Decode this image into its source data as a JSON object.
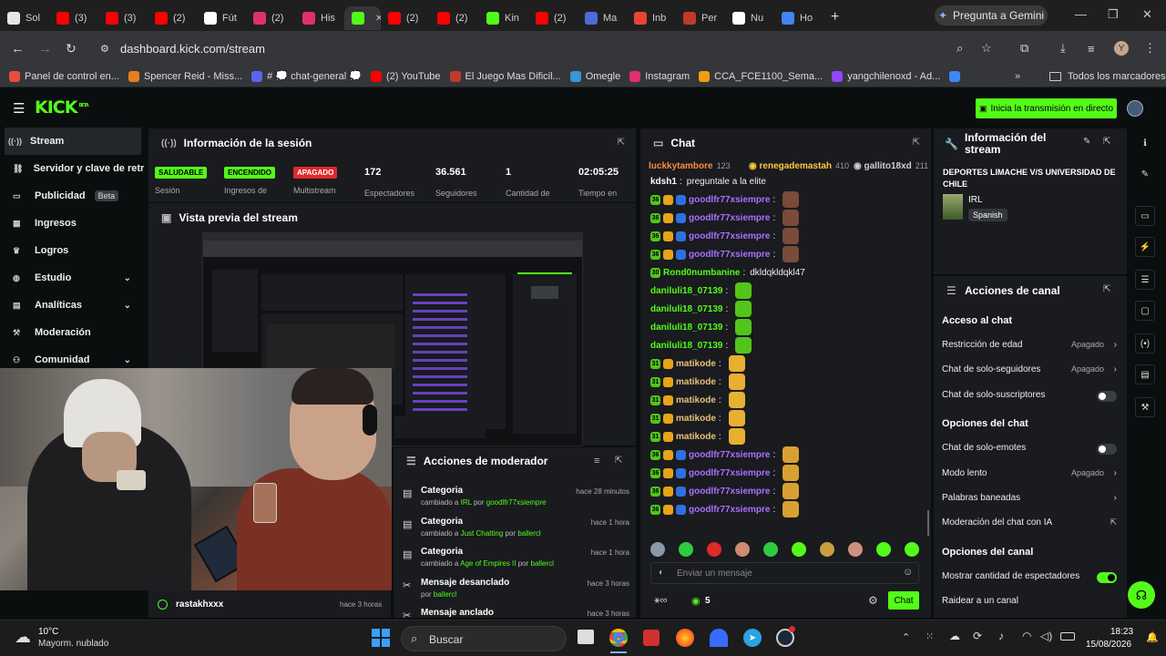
{
  "browser": {
    "tabs": [
      {
        "label": "Sol",
        "color": "#e6e6e6"
      },
      {
        "label": "(3)",
        "color": "#ff0000"
      },
      {
        "label": "(3)",
        "color": "#ff0000"
      },
      {
        "label": "(2)",
        "color": "#ff0000"
      },
      {
        "label": "Fút",
        "color": "#ffffff"
      },
      {
        "label": "(2)",
        "color": "#e1306c"
      },
      {
        "label": "His",
        "color": "#e1306c"
      },
      {
        "label": "",
        "color": "#53fc18"
      },
      {
        "label": "(2)",
        "color": "#ff0000"
      },
      {
        "label": "(2)",
        "color": "#ff0000"
      },
      {
        "label": "Kin",
        "color": "#53fc18"
      },
      {
        "label": "(2)",
        "color": "#ff0000"
      },
      {
        "label": "Ma",
        "color": "#4d6ad6"
      },
      {
        "label": "Inb",
        "color": "#ea4335"
      },
      {
        "label": "Per",
        "color": "#c0392b"
      },
      {
        "label": "Nu",
        "color": "#ffffff"
      },
      {
        "label": "Ho",
        "color": "#4285f4"
      }
    ],
    "new_tab": "+",
    "gemini_label": "Pregunta a Gemini",
    "url": "dashboard.kick.com/stream",
    "profile_initial": "Y",
    "bookmarks": [
      {
        "label": "Panel de control en...",
        "color": "#e74c3c"
      },
      {
        "label": "Spencer Reid - Miss...",
        "color": "#e67e22"
      },
      {
        "label": "# 💭 chat-general 💭",
        "color": "#5865f2"
      },
      {
        "label": "(2) YouTube",
        "color": "#ff0000"
      },
      {
        "label": "El Juego Mas Dificil...",
        "color": "#c0392b"
      },
      {
        "label": "Omegle",
        "color": "#3498db"
      },
      {
        "label": "Instagram",
        "color": "#e1306c"
      },
      {
        "label": "CCA_FCE1100_Sema...",
        "color": "#f39c12"
      },
      {
        "label": "yangchilenoxd - Ad...",
        "color": "#9146ff"
      },
      {
        "label": "",
        "color": "#4285f4"
      }
    ],
    "all_bookmarks": "Todos los marcadores"
  },
  "kick": {
    "logo": "KICK",
    "logo_sup": "BETA",
    "go_live": "Inicia la transmisión en directo"
  },
  "sidebar": {
    "items": [
      {
        "label": "Stream",
        "icon": "stream-icon",
        "chev": ""
      },
      {
        "label": "Servidor y clave de retran",
        "icon": "link-icon",
        "chev": ""
      },
      {
        "label": "Publicidad",
        "icon": "tv-icon",
        "chev": "",
        "badge": "Beta"
      },
      {
        "label": "Ingresos",
        "icon": "grid-icon",
        "chev": ""
      },
      {
        "label": "Logros",
        "icon": "trophy-icon",
        "chev": ""
      },
      {
        "label": "Estudio",
        "icon": "palette-icon",
        "chev": "⌄"
      },
      {
        "label": "Analíticas",
        "icon": "chart-icon",
        "chev": "⌄"
      },
      {
        "label": "Moderación",
        "icon": "gavel-icon",
        "chev": ""
      },
      {
        "label": "Comunidad",
        "icon": "people-icon",
        "chev": "⌄"
      }
    ]
  },
  "session": {
    "title": "Información de la sesión",
    "stats": [
      {
        "badge": "SALUDABLE",
        "badge_bg": "#53fc18",
        "badge_fg": "#000",
        "label": "Sesión"
      },
      {
        "badge": "ENCENDIDO",
        "badge_bg": "#53fc18",
        "badge_fg": "#000",
        "label": "Ingresos de"
      },
      {
        "badge": "APAGADO",
        "badge_bg": "#e0292b",
        "badge_fg": "#fff",
        "label": "Multistream"
      },
      {
        "value": "172",
        "label": "Espectadores"
      },
      {
        "value": "36.561",
        "label": "Seguidores"
      },
      {
        "value": "1",
        "label": "Cantidad de"
      },
      {
        "value": "02:05:25",
        "label": "Tiempo en"
      }
    ]
  },
  "preview": {
    "title": "Vista previa del stream"
  },
  "moderator": {
    "title": "Acciones de moderador",
    "items": [
      {
        "title": "Categoria",
        "pre": "cambiado a ",
        "target": "IRL",
        "mid": " por ",
        "user": "goodlfr77xsiempre",
        "when": "hace 28 minutos"
      },
      {
        "title": "Categoria",
        "pre": "cambiado a ",
        "target": "Just Chatting",
        "mid": " por ",
        "user": "ballercl",
        "when": "hace 1 hora"
      },
      {
        "title": "Categoria",
        "pre": "cambiado a ",
        "target": "Age of Empires II",
        "mid": " por ",
        "user": "ballercl",
        "when": "hace 1 hora"
      },
      {
        "title": "Mensaje desanclado",
        "pre": "",
        "target": "",
        "mid": "por ",
        "user": "ballercl",
        "when": "hace 3 horas"
      },
      {
        "title": "Mensaje anclado",
        "pre": "",
        "target": "",
        "mid": "",
        "user": "",
        "when": "hace 3 horas"
      }
    ]
  },
  "activity": {
    "user": "rastakhxxx",
    "when": "hace 3 horas"
  },
  "chat": {
    "title": "Chat",
    "top_users": [
      {
        "name": "luckkytambore",
        "count": "123"
      },
      {
        "name": "renegademastah",
        "count": "410"
      },
      {
        "name": "gallito18xd",
        "count": "211"
      }
    ],
    "messages": [
      {
        "user": "kdsh1",
        "color": "#ffffff",
        "text": "preguntale a la elite",
        "badges": [],
        "emote": ""
      },
      {
        "user": "goodlfr77xsiempre",
        "color": "#a970ff",
        "text": "",
        "badges": [
          "36",
          "crown",
          "bolt"
        ],
        "emote": "#7a4a3a"
      },
      {
        "user": "goodlfr77xsiempre",
        "color": "#a970ff",
        "text": "",
        "badges": [
          "36",
          "crown",
          "bolt"
        ],
        "emote": "#7a4a3a"
      },
      {
        "user": "goodlfr77xsiempre",
        "color": "#a970ff",
        "text": "",
        "badges": [
          "36",
          "crown",
          "bolt"
        ],
        "emote": "#7a4a3a"
      },
      {
        "user": "goodlfr77xsiempre",
        "color": "#a970ff",
        "text": "",
        "badges": [
          "36",
          "crown",
          "bolt"
        ],
        "emote": "#7a4a3a"
      },
      {
        "user": "Rond0numbanine",
        "color": "#53fc18",
        "text": "dkldqkldqkl47",
        "badges": [
          "30"
        ],
        "emote": ""
      },
      {
        "user": "daniluli18_07139",
        "color": "#53fc18",
        "text": "",
        "badges": [],
        "emote": "#53c51a"
      },
      {
        "user": "daniluli18_07139",
        "color": "#53fc18",
        "text": "",
        "badges": [],
        "emote": "#53c51a"
      },
      {
        "user": "daniluli18_07139",
        "color": "#53fc18",
        "text": "",
        "badges": [],
        "emote": "#53c51a"
      },
      {
        "user": "daniluli18_07139",
        "color": "#53fc18",
        "text": "",
        "badges": [],
        "emote": "#53c51a"
      },
      {
        "user": "matikode",
        "color": "#e5c07b",
        "text": "",
        "badges": [
          "31",
          "crown"
        ],
        "emote": "#e8b030"
      },
      {
        "user": "matikode",
        "color": "#e5c07b",
        "text": "",
        "badges": [
          "31",
          "crown"
        ],
        "emote": "#e8b030"
      },
      {
        "user": "matikode",
        "color": "#e5c07b",
        "text": "",
        "badges": [
          "31",
          "crown"
        ],
        "emote": "#e8b030"
      },
      {
        "user": "matikode",
        "color": "#e5c07b",
        "text": "",
        "badges": [
          "31",
          "crown"
        ],
        "emote": "#e8b030"
      },
      {
        "user": "matikode",
        "color": "#e5c07b",
        "text": "",
        "badges": [
          "31",
          "crown"
        ],
        "emote": "#e8b030"
      },
      {
        "user": "goodlfr77xsiempre",
        "color": "#a970ff",
        "text": "",
        "badges": [
          "36",
          "crown",
          "bolt"
        ],
        "emote": "#d8a030"
      },
      {
        "user": "goodlfr77xsiempre",
        "color": "#a970ff",
        "text": "",
        "badges": [
          "36",
          "crown",
          "bolt"
        ],
        "emote": "#d8a030"
      },
      {
        "user": "goodlfr77xsiempre",
        "color": "#a970ff",
        "text": "",
        "badges": [
          "36",
          "crown",
          "bolt"
        ],
        "emote": "#d8a030"
      },
      {
        "user": "goodlfr77xsiempre",
        "color": "#a970ff",
        "text": "",
        "badges": [
          "36",
          "crown",
          "bolt"
        ],
        "emote": "#d8a030"
      }
    ],
    "emote_bar": [
      "#8899aa",
      "#2ecc40",
      "#e0292b",
      "#d08a70",
      "#2ecc40",
      "#53fc18",
      "#c8a040",
      "#d09080",
      "#53fc18",
      "#53fc18"
    ],
    "input_placeholder": "Enviar un mensaje",
    "points": "5",
    "send_label": "Chat"
  },
  "stream_info": {
    "title": "Información del stream",
    "stream_title": "DEPORTES LIMACHE V/S UNIVERSIDAD DE CHILE",
    "category": "IRL",
    "language": "Spanish"
  },
  "channel_actions": {
    "title": "Acciones de canal",
    "sections": [
      {
        "heading": "Acceso al chat",
        "options": [
          {
            "label": "Restricción de edad",
            "value": "Apagado",
            "kind": "arrow"
          },
          {
            "label": "Chat de solo-seguidores",
            "value": "Apagado",
            "kind": "arrow"
          },
          {
            "label": "Chat de solo-suscriptores",
            "value": "",
            "kind": "toggle-off"
          }
        ]
      },
      {
        "heading": "Opciones del chat",
        "options": [
          {
            "label": "Chat de solo-emotes",
            "value": "",
            "kind": "toggle-off"
          },
          {
            "label": "Modo lento",
            "value": "Apagado",
            "kind": "arrow"
          },
          {
            "label": "Palabras baneadas",
            "value": "",
            "kind": "arrow"
          },
          {
            "label": "Moderación del chat con IA",
            "value": "",
            "kind": "external"
          }
        ]
      },
      {
        "heading": "Opciones del canal",
        "options": [
          {
            "label": "Mostrar cantidad de espectadores",
            "value": "",
            "kind": "toggle-on"
          },
          {
            "label": "Raidear a un canal",
            "value": "",
            "kind": ""
          }
        ]
      }
    ]
  },
  "taskbar": {
    "temperature": "10°C",
    "weather": "Mayorm. nublado",
    "search_placeholder": "Buscar",
    "time": "18:23",
    "date": "15/08/2026"
  }
}
